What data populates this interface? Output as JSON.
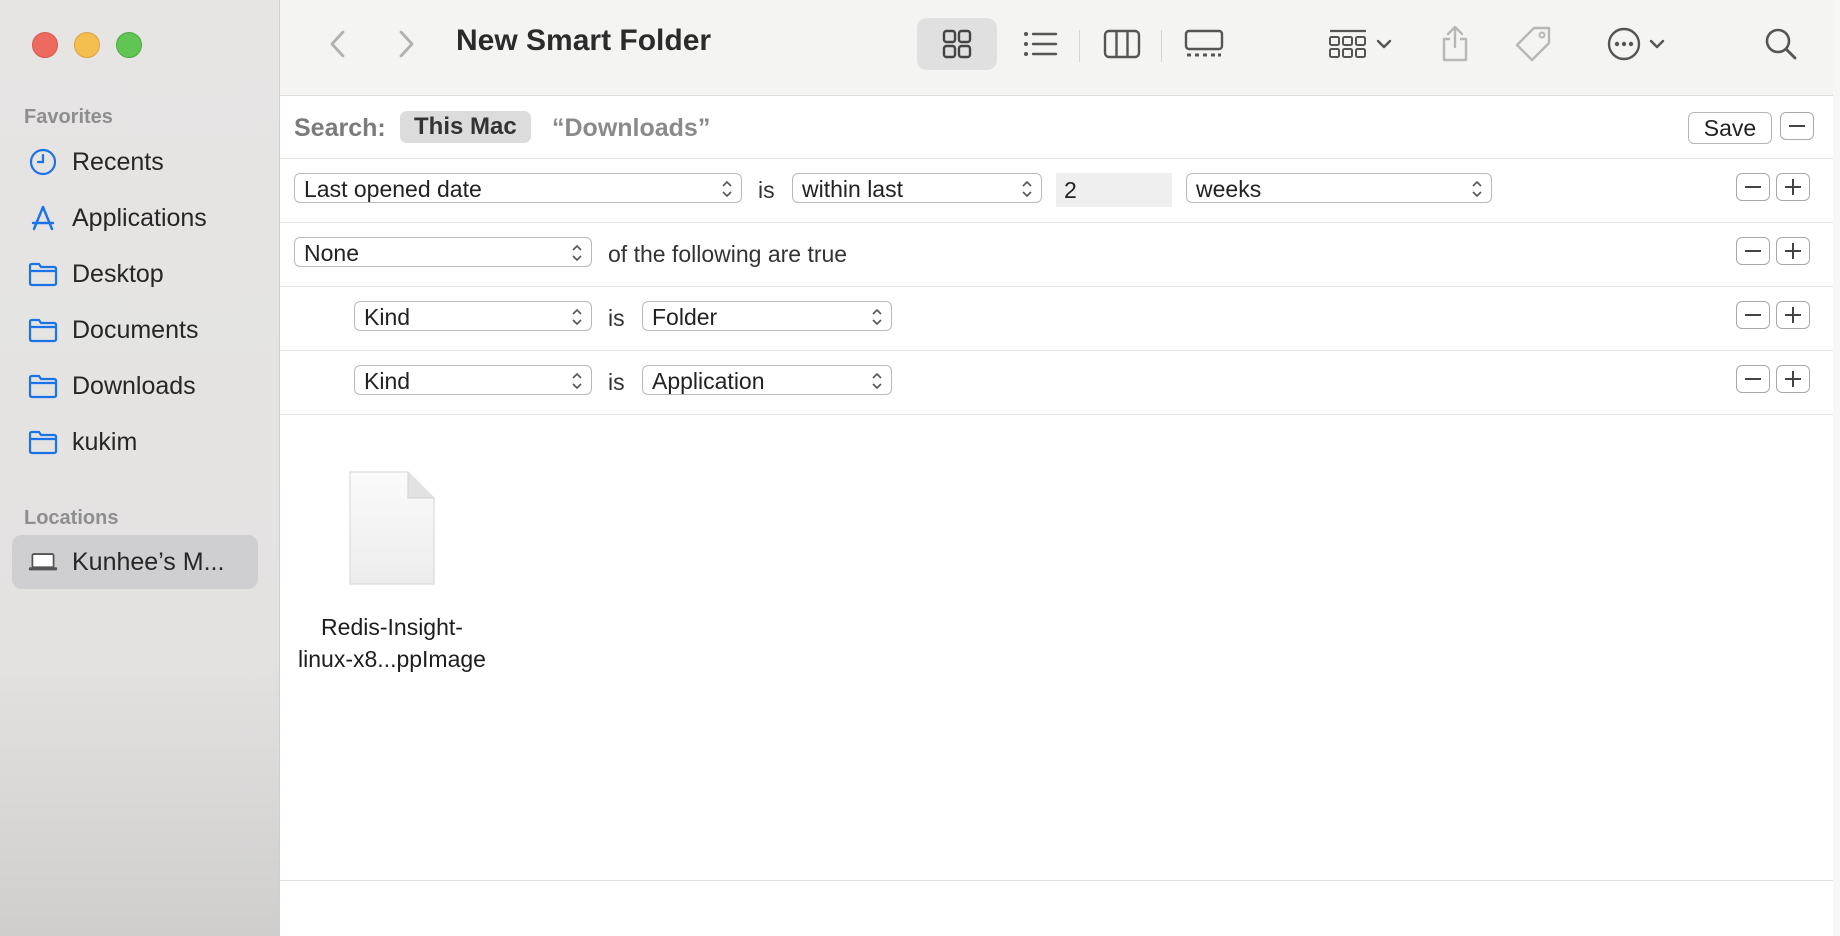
{
  "window": {
    "title": "New Smart Folder"
  },
  "sidebar": {
    "favorites_heading": "Favorites",
    "favorites": [
      {
        "label": "Recents",
        "icon": "clock-icon"
      },
      {
        "label": "Applications",
        "icon": "applications-icon"
      },
      {
        "label": "Desktop",
        "icon": "folder-icon"
      },
      {
        "label": "Documents",
        "icon": "folder-icon"
      },
      {
        "label": "Downloads",
        "icon": "folder-icon"
      },
      {
        "label": "kukim",
        "icon": "folder-icon"
      }
    ],
    "locations_heading": "Locations",
    "locations": [
      {
        "label": "Kunhee’s M...",
        "icon": "laptop-icon",
        "selected": true
      }
    ]
  },
  "search": {
    "label": "Search:",
    "scope_selected": "This Mac",
    "scope_other": "“Downloads”",
    "save_label": "Save"
  },
  "rules": {
    "row1": {
      "attribute": "Last opened date",
      "is": "is",
      "operator": "within last",
      "value": "2",
      "unit": "weeks"
    },
    "row2": {
      "quantifier": "None",
      "text": "of the following are true"
    },
    "row3": {
      "attribute": "Kind",
      "is": "is",
      "value": "Folder"
    },
    "row4": {
      "attribute": "Kind",
      "is": "is",
      "value": "Application"
    }
  },
  "files": [
    {
      "line1": "Redis-Insight-",
      "line2": "linux-x8...ppImage"
    }
  ],
  "colors": {
    "accent": "#1a73e8",
    "close": "#ed6a5e",
    "minimize": "#f5bf4f",
    "zoom": "#61c554"
  }
}
